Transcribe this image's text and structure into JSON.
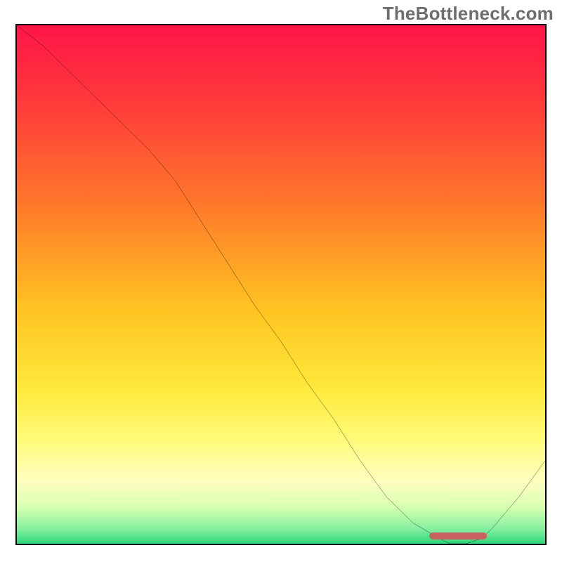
{
  "watermark": "TheBottleneck.com",
  "chart_data": {
    "type": "line",
    "title": "",
    "xlabel": "",
    "ylabel": "",
    "xlim": [
      0,
      100
    ],
    "ylim": [
      0,
      100
    ],
    "gradient_stops": [
      {
        "offset": 0,
        "color": "#ff1648"
      },
      {
        "offset": 0.15,
        "color": "#ff3a3a"
      },
      {
        "offset": 0.35,
        "color": "#ff7a2a"
      },
      {
        "offset": 0.55,
        "color": "#ffc421"
      },
      {
        "offset": 0.7,
        "color": "#ffe93a"
      },
      {
        "offset": 0.8,
        "color": "#fffb7a"
      },
      {
        "offset": 0.88,
        "color": "#ffffc0"
      },
      {
        "offset": 0.93,
        "color": "#d6ffb0"
      },
      {
        "offset": 0.97,
        "color": "#88f0a0"
      },
      {
        "offset": 1.0,
        "color": "#2fd67a"
      }
    ],
    "bottleneck_curve": {
      "x": [
        0,
        5,
        10,
        15,
        20,
        25,
        30,
        35,
        40,
        45,
        50,
        55,
        60,
        65,
        70,
        75,
        80,
        82,
        85,
        88,
        90,
        95,
        100
      ],
      "y": [
        100,
        96,
        91,
        86,
        81,
        76,
        70,
        62,
        54,
        46,
        39,
        31,
        24,
        16,
        9,
        4,
        1,
        0,
        0,
        1,
        3,
        9,
        16
      ]
    },
    "optimal_range": {
      "x_start": 78,
      "x_end": 89,
      "y": 0.8
    }
  }
}
